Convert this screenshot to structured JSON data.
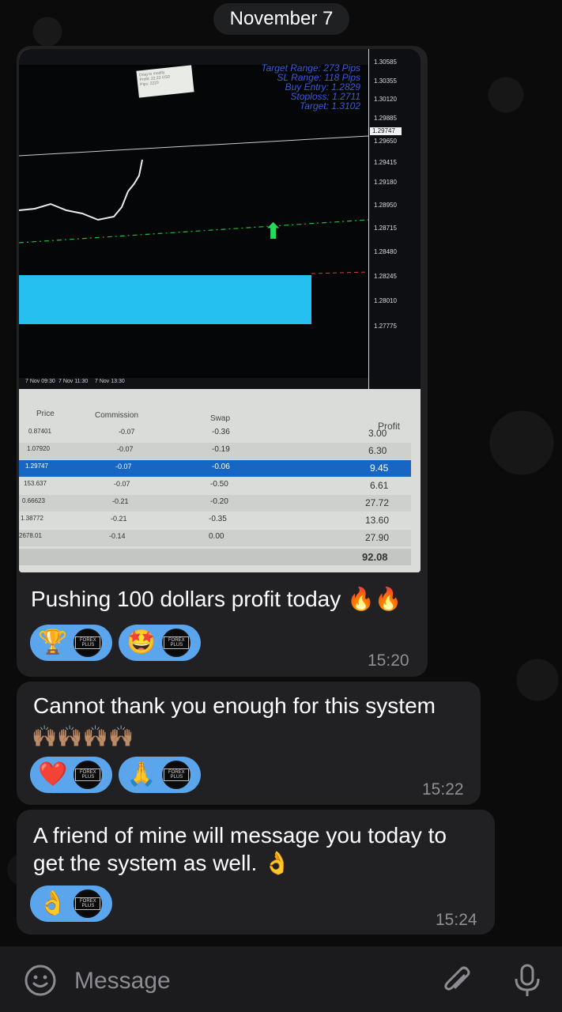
{
  "header": {
    "date": "November 7"
  },
  "messages": [
    {
      "text": "Pushing 100 dollars profit today 🔥🔥",
      "time": "15:20",
      "reactions": [
        {
          "emoji": "🏆",
          "icon": "trophy-icon",
          "avatar_label": "FOREX PLUS"
        },
        {
          "emoji": "🤩",
          "icon": "star-struck-icon",
          "avatar_label": "FOREX PLUS"
        }
      ],
      "screenshot": {
        "stats": {
          "target_range": "Target Range: 273 Pips",
          "sl_range": "SL Range: 118 Pips",
          "buy_entry": "Buy Entry: 1.2829",
          "stoploss": "Stoploss: 1.2711",
          "target": "Target: 1.3102"
        },
        "tooltip": [
          "Drag to modify",
          "Profit: 22.23 USD",
          "Pips: 2223"
        ],
        "price_ticks": [
          "1.30585",
          "1.30355",
          "1.30120",
          "1.29885",
          "1.29650",
          "1.29415",
          "1.29180",
          "1.28950",
          "1.28715",
          "1.28480",
          "1.28245",
          "1.28010",
          "1.27775"
        ],
        "current_price": "1.29747",
        "time_ticks": [
          "7 Nov 09:30",
          "7 Nov 11:30",
          "7 Nov 13:30"
        ],
        "table_headers": {
          "price": "Price",
          "commission": "Commission",
          "swap": "Swap",
          "profit": "Profit"
        },
        "rows": [
          {
            "price": "0.87401",
            "commission": "-0.07",
            "swap": "-0.36",
            "profit": "3.00"
          },
          {
            "price": "1.07920",
            "commission": "-0.07",
            "swap": "-0.19",
            "profit": "6.30"
          },
          {
            "price": "1.29747",
            "commission": "-0.07",
            "swap": "-0.06",
            "profit": "9.45"
          },
          {
            "price": "153.637",
            "commission": "-0.07",
            "swap": "-0.50",
            "profit": "6.61"
          },
          {
            "price": "0.66623",
            "commission": "-0.21",
            "swap": "-0.20",
            "profit": "27.72"
          },
          {
            "price": "1.38772",
            "commission": "-0.21",
            "swap": "-0.35",
            "profit": "13.60"
          },
          {
            "price": "2678.01",
            "commission": "-0.14",
            "swap": "0.00",
            "profit": "27.90"
          }
        ],
        "total_profit": "92.08"
      }
    },
    {
      "text": "Cannot thank you enough for this system",
      "emoji_line": "🙌🏽🙌🏽🙌🏽🙌🏽",
      "time": "15:22",
      "reactions": [
        {
          "emoji": "❤️",
          "icon": "heart-icon",
          "avatar_label": "FOREX PLUS"
        },
        {
          "emoji": "🙏",
          "icon": "pray-icon",
          "avatar_label": "FOREX PLUS"
        }
      ]
    },
    {
      "text_line1": "A friend of mine will message you today to",
      "text_line2": "get the system as well. 👌",
      "time": "15:24",
      "reactions": [
        {
          "emoji": "👌",
          "icon": "ok-hand-icon",
          "avatar_label": "FOREX PLUS"
        }
      ]
    }
  ],
  "composer": {
    "placeholder": "Message"
  },
  "colors": {
    "background": "#0b0b0c",
    "bubble": "#212124",
    "reaction": "#5aa5ec",
    "selected_row": "#1766c4"
  }
}
